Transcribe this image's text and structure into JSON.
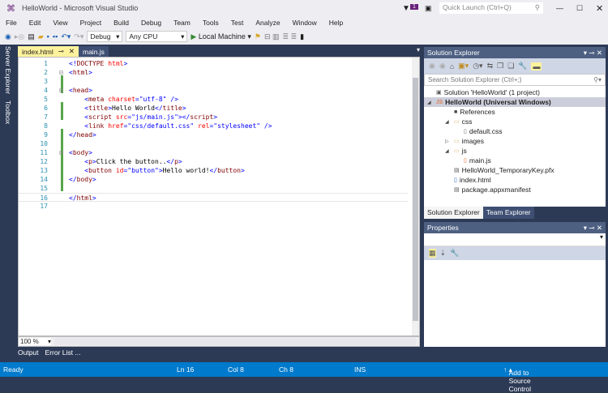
{
  "title": "HelloWorld - Microsoft Visual Studio",
  "notification_count": "1",
  "quick_launch_placeholder": "Quick Launch (Ctrl+Q)",
  "menu": [
    "File",
    "Edit",
    "View",
    "Project",
    "Build",
    "Debug",
    "Team",
    "Tools",
    "Test",
    "Analyze",
    "Window",
    "Help"
  ],
  "toolbar": {
    "config": "Debug",
    "platform": "Any CPU",
    "run_label": "Local Machine"
  },
  "left_strip": [
    "Server Explorer",
    "Toolbox"
  ],
  "tabs": [
    {
      "label": "index.html",
      "active": true
    },
    {
      "label": "main.js",
      "active": false
    }
  ],
  "code_lines": [
    [
      [
        "p",
        "<!"
      ],
      [
        "t",
        "DOCTYPE"
      ],
      [
        "x",
        " "
      ],
      [
        "a",
        "html"
      ],
      [
        "p",
        ">"
      ]
    ],
    [
      [
        "p",
        "<"
      ],
      [
        "t",
        "html"
      ],
      [
        "p",
        ">"
      ]
    ],
    [],
    [
      [
        "p",
        "<"
      ],
      [
        "t",
        "head"
      ],
      [
        "p",
        ">"
      ]
    ],
    [
      [
        "x",
        "    "
      ],
      [
        "p",
        "<"
      ],
      [
        "t",
        "meta"
      ],
      [
        "x",
        " "
      ],
      [
        "a",
        "charset"
      ],
      [
        "p",
        "="
      ],
      [
        "v",
        "\"utf-8\""
      ],
      [
        "x",
        " "
      ],
      [
        "p",
        "/>"
      ]
    ],
    [
      [
        "x",
        "    "
      ],
      [
        "p",
        "<"
      ],
      [
        "t",
        "title"
      ],
      [
        "p",
        ">"
      ],
      [
        "x",
        "Hello World"
      ],
      [
        "p",
        "</"
      ],
      [
        "t",
        "title"
      ],
      [
        "p",
        ">"
      ]
    ],
    [
      [
        "x",
        "    "
      ],
      [
        "p",
        "<"
      ],
      [
        "t",
        "script"
      ],
      [
        "x",
        " "
      ],
      [
        "a",
        "src"
      ],
      [
        "p",
        "="
      ],
      [
        "v",
        "\"js/main.js\""
      ],
      [
        "p",
        "></"
      ],
      [
        "t",
        "script"
      ],
      [
        "p",
        ">"
      ]
    ],
    [
      [
        "x",
        "    "
      ],
      [
        "p",
        "<"
      ],
      [
        "t",
        "link"
      ],
      [
        "x",
        " "
      ],
      [
        "a",
        "href"
      ],
      [
        "p",
        "="
      ],
      [
        "v",
        "\"css/default.css\""
      ],
      [
        "x",
        " "
      ],
      [
        "a",
        "rel"
      ],
      [
        "p",
        "="
      ],
      [
        "v",
        "\"stylesheet\""
      ],
      [
        "x",
        " "
      ],
      [
        "p",
        "/>"
      ]
    ],
    [
      [
        "p",
        "</"
      ],
      [
        "t",
        "head"
      ],
      [
        "p",
        ">"
      ]
    ],
    [],
    [
      [
        "p",
        "<"
      ],
      [
        "t",
        "body"
      ],
      [
        "p",
        ">"
      ]
    ],
    [
      [
        "x",
        "    "
      ],
      [
        "p",
        "<"
      ],
      [
        "t",
        "p"
      ],
      [
        "p",
        ">"
      ],
      [
        "x",
        "Click the button.."
      ],
      [
        "p",
        "</"
      ],
      [
        "t",
        "p"
      ],
      [
        "p",
        ">"
      ]
    ],
    [
      [
        "x",
        "    "
      ],
      [
        "p",
        "<"
      ],
      [
        "t",
        "button"
      ],
      [
        "x",
        " "
      ],
      [
        "a",
        "id"
      ],
      [
        "p",
        "="
      ],
      [
        "v",
        "\"button\""
      ],
      [
        "p",
        ">"
      ],
      [
        "x",
        "Hello world!"
      ],
      [
        "p",
        "</"
      ],
      [
        "t",
        "button"
      ],
      [
        "p",
        ">"
      ]
    ],
    [
      [
        "p",
        "</"
      ],
      [
        "t",
        "body"
      ],
      [
        "p",
        ">"
      ]
    ],
    [],
    [
      [
        "p",
        "</"
      ],
      [
        "t",
        "html"
      ],
      [
        "p",
        ">"
      ]
    ],
    []
  ],
  "zoom_level": "100 %",
  "bottom_tabs": [
    "Output",
    "Error List ..."
  ],
  "status": {
    "ready": "Ready",
    "ln": "Ln 16",
    "col": "Col 8",
    "ch": "Ch 8",
    "mode": "INS",
    "source_control": "Add to Source Control"
  },
  "solution_explorer": {
    "title": "Solution Explorer",
    "search_placeholder": "Search Solution Explorer (Ctrl+;)",
    "items": [
      {
        "label": "Solution 'HelloWorld' (1 project)",
        "depth": 0,
        "expander": ""
      },
      {
        "label": "HelloWorld (Universal Windows)",
        "depth": 0,
        "expander": "◢",
        "bold": true
      },
      {
        "label": "References",
        "depth": 1,
        "expander": ""
      },
      {
        "label": "css",
        "depth": 1,
        "expander": "◢"
      },
      {
        "label": "default.css",
        "depth": 2,
        "expander": ""
      },
      {
        "label": "images",
        "depth": 1,
        "expander": "▷"
      },
      {
        "label": "js",
        "depth": 1,
        "expander": "◢"
      },
      {
        "label": "main.js",
        "depth": 2,
        "expander": ""
      },
      {
        "label": "HelloWorld_TemporaryKey.pfx",
        "depth": 1,
        "expander": ""
      },
      {
        "label": "index.html",
        "depth": 1,
        "expander": ""
      },
      {
        "label": "package.appxmanifest",
        "depth": 1,
        "expander": ""
      }
    ],
    "tabs": [
      "Solution Explorer",
      "Team Explorer"
    ]
  },
  "properties": {
    "title": "Properties"
  }
}
